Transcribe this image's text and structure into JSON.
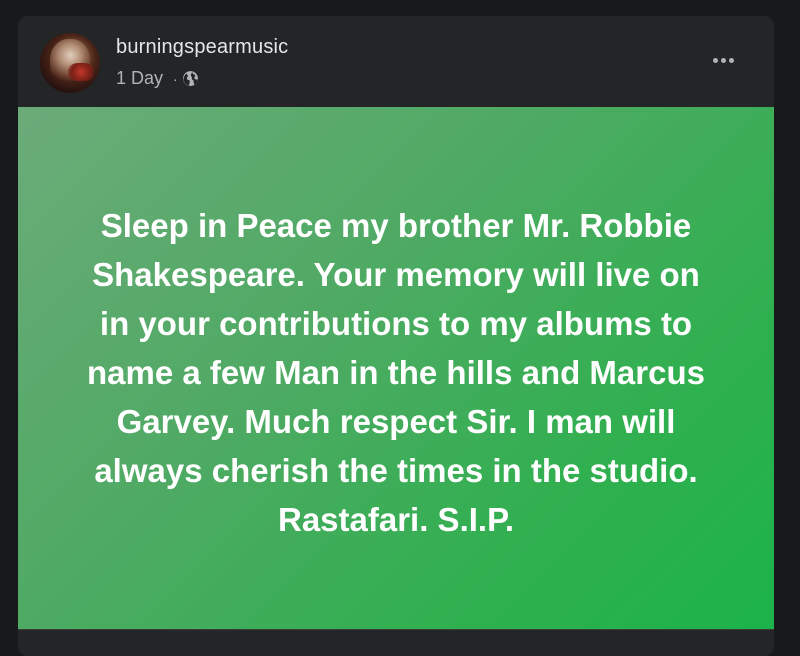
{
  "post": {
    "author": "burningspearmusic",
    "time": "1 Day",
    "separator": "·",
    "privacy_icon": "globe-icon",
    "text": "Sleep in Peace my brother Mr. Robbie\nShakespeare. Your memory will live on\nin your contributions to my albums to\nname a few Man in the hills and Marcus\nGarvey. Much respect Sir. I man will\nalways cherish the times in the studio.\nRastafari. S.I.P.",
    "background_color_start": "#6bab79",
    "background_color_end": "#1cb34a",
    "text_color": "#ffffff"
  },
  "menu": {
    "icon": "more-horizontal-icon"
  },
  "theme": {
    "page_background": "#18191a",
    "card_background": "#242526",
    "primary_text": "#e4e6eb",
    "secondary_text": "#b0b3b8"
  }
}
